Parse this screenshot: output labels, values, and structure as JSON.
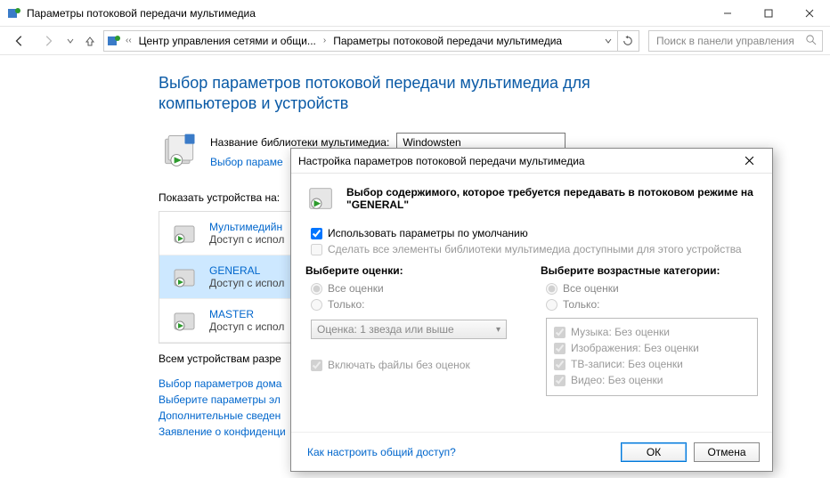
{
  "window": {
    "title": "Параметры потоковой передачи мультимедиа"
  },
  "breadcrumb": {
    "seg1": "Центр управления сетями и общи...",
    "seg2": "Параметры потоковой передачи мультимедиа"
  },
  "search": {
    "placeholder": "Поиск в панели управления"
  },
  "page": {
    "title": "Выбор параметров потоковой передачи мультимедиа для компьютеров и устройств",
    "library_label": "Название библиотеки мультимедиа:",
    "library_value": "Windowsten",
    "choose_params_link": "Выбор параме",
    "show_devices_label": "Показать устройства на:",
    "all_devices_label": "Всем устройствам разре",
    "devices": [
      {
        "name": "Мультимедийн",
        "sub": "Доступ с испол"
      },
      {
        "name": "GENERAL",
        "sub": "Доступ с испол"
      },
      {
        "name": "MASTER",
        "sub": "Доступ с испол"
      }
    ],
    "links": {
      "l1": "Выбор параметров дома",
      "l2": "Выберите параметры эл",
      "l3": "Дополнительные сведен",
      "l4": "Заявление о конфиденци"
    }
  },
  "dialog": {
    "title": "Настройка параметров потоковой передачи мультимедиа",
    "head": "Выбор содержимого, которое требуется передавать в потоковом режиме на \"GENERAL\"",
    "cb_default": "Использовать параметры по умолчанию",
    "cb_all": "Сделать все элементы библиотеки мультимедиа доступными для этого устройства",
    "col_ratings": "Выберите оценки:",
    "col_parental": "Выберите возрастные категории:",
    "r_all": "Все оценки",
    "r_only": "Только:",
    "combo": "Оценка: 1 звезда или выше",
    "cb_unrated": "Включать файлы без оценок",
    "content": {
      "music": "Музыка: Без оценки",
      "images": "Изображения: Без оценки",
      "tv": "ТВ-записи: Без оценки",
      "video": "Видео: Без оценки"
    },
    "help_link": "Как настроить общий доступ?",
    "ok": "ОК",
    "cancel": "Отмена"
  }
}
